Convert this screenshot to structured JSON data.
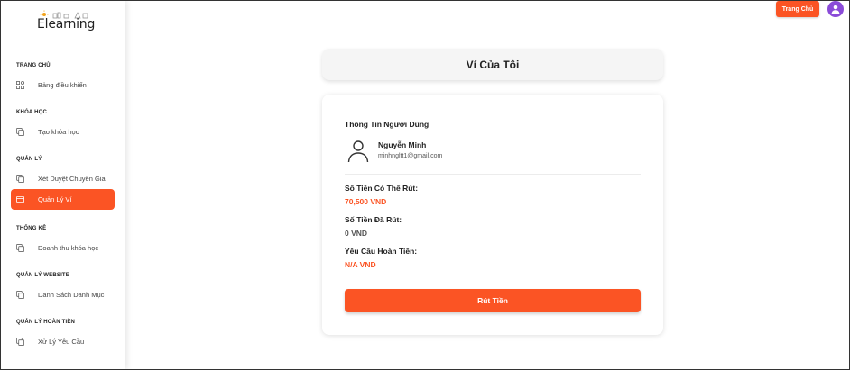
{
  "brand": {
    "logo_text": "Elearning",
    "accent_color": "#fb5424",
    "avatar_color": "#8a4bd8"
  },
  "sidebar": {
    "sections": [
      {
        "title": "TRANG CHỦ",
        "items": [
          {
            "label": "Bảng điều khiển",
            "icon": "dashboard-icon",
            "active": false
          }
        ]
      },
      {
        "title": "KHÓA HỌC",
        "items": [
          {
            "label": "Tạo khóa học",
            "icon": "copy-icon",
            "active": false
          }
        ]
      },
      {
        "title": "QUẢN LÝ",
        "items": [
          {
            "label": "Xét Duyệt Chuyên Gia",
            "icon": "copy-icon",
            "active": false
          },
          {
            "label": "Quản Lý Ví",
            "icon": "wallet-icon",
            "active": true
          }
        ]
      },
      {
        "title": "THỐNG KÊ",
        "items": [
          {
            "label": "Doanh thu khóa học",
            "icon": "copy-icon",
            "active": false
          }
        ]
      },
      {
        "title": "QUẢN LÝ WEBSITE",
        "items": [
          {
            "label": "Danh Sách Danh Mục",
            "icon": "copy-icon",
            "active": false
          }
        ]
      },
      {
        "title": "QUẢN LÝ HOÀN TIỀN",
        "items": [
          {
            "label": "Xử Lý Yêu Cầu",
            "icon": "copy-icon",
            "active": false
          }
        ]
      }
    ]
  },
  "header": {
    "home_button": "Trang Chủ",
    "avatar_icon": "user-avatar-icon"
  },
  "main": {
    "title": "Ví Của Tôi",
    "wallet": {
      "heading": "Thông Tin Người Dùng",
      "user_name": "Nguyễn Minh",
      "user_email": "minhngltt1@gmail.com",
      "fields": [
        {
          "label": "Số Tiền Có Thể Rút:",
          "value": "70,500 VND",
          "color": "#fb5424"
        },
        {
          "label": "Số Tiền Đã Rút:",
          "value": "0 VND",
          "color": "#555555"
        },
        {
          "label": "Yêu Cầu Hoàn Tiền:",
          "value": "N/A VND",
          "color": "#fb5424"
        }
      ],
      "withdraw_button": "Rút Tiền"
    }
  }
}
